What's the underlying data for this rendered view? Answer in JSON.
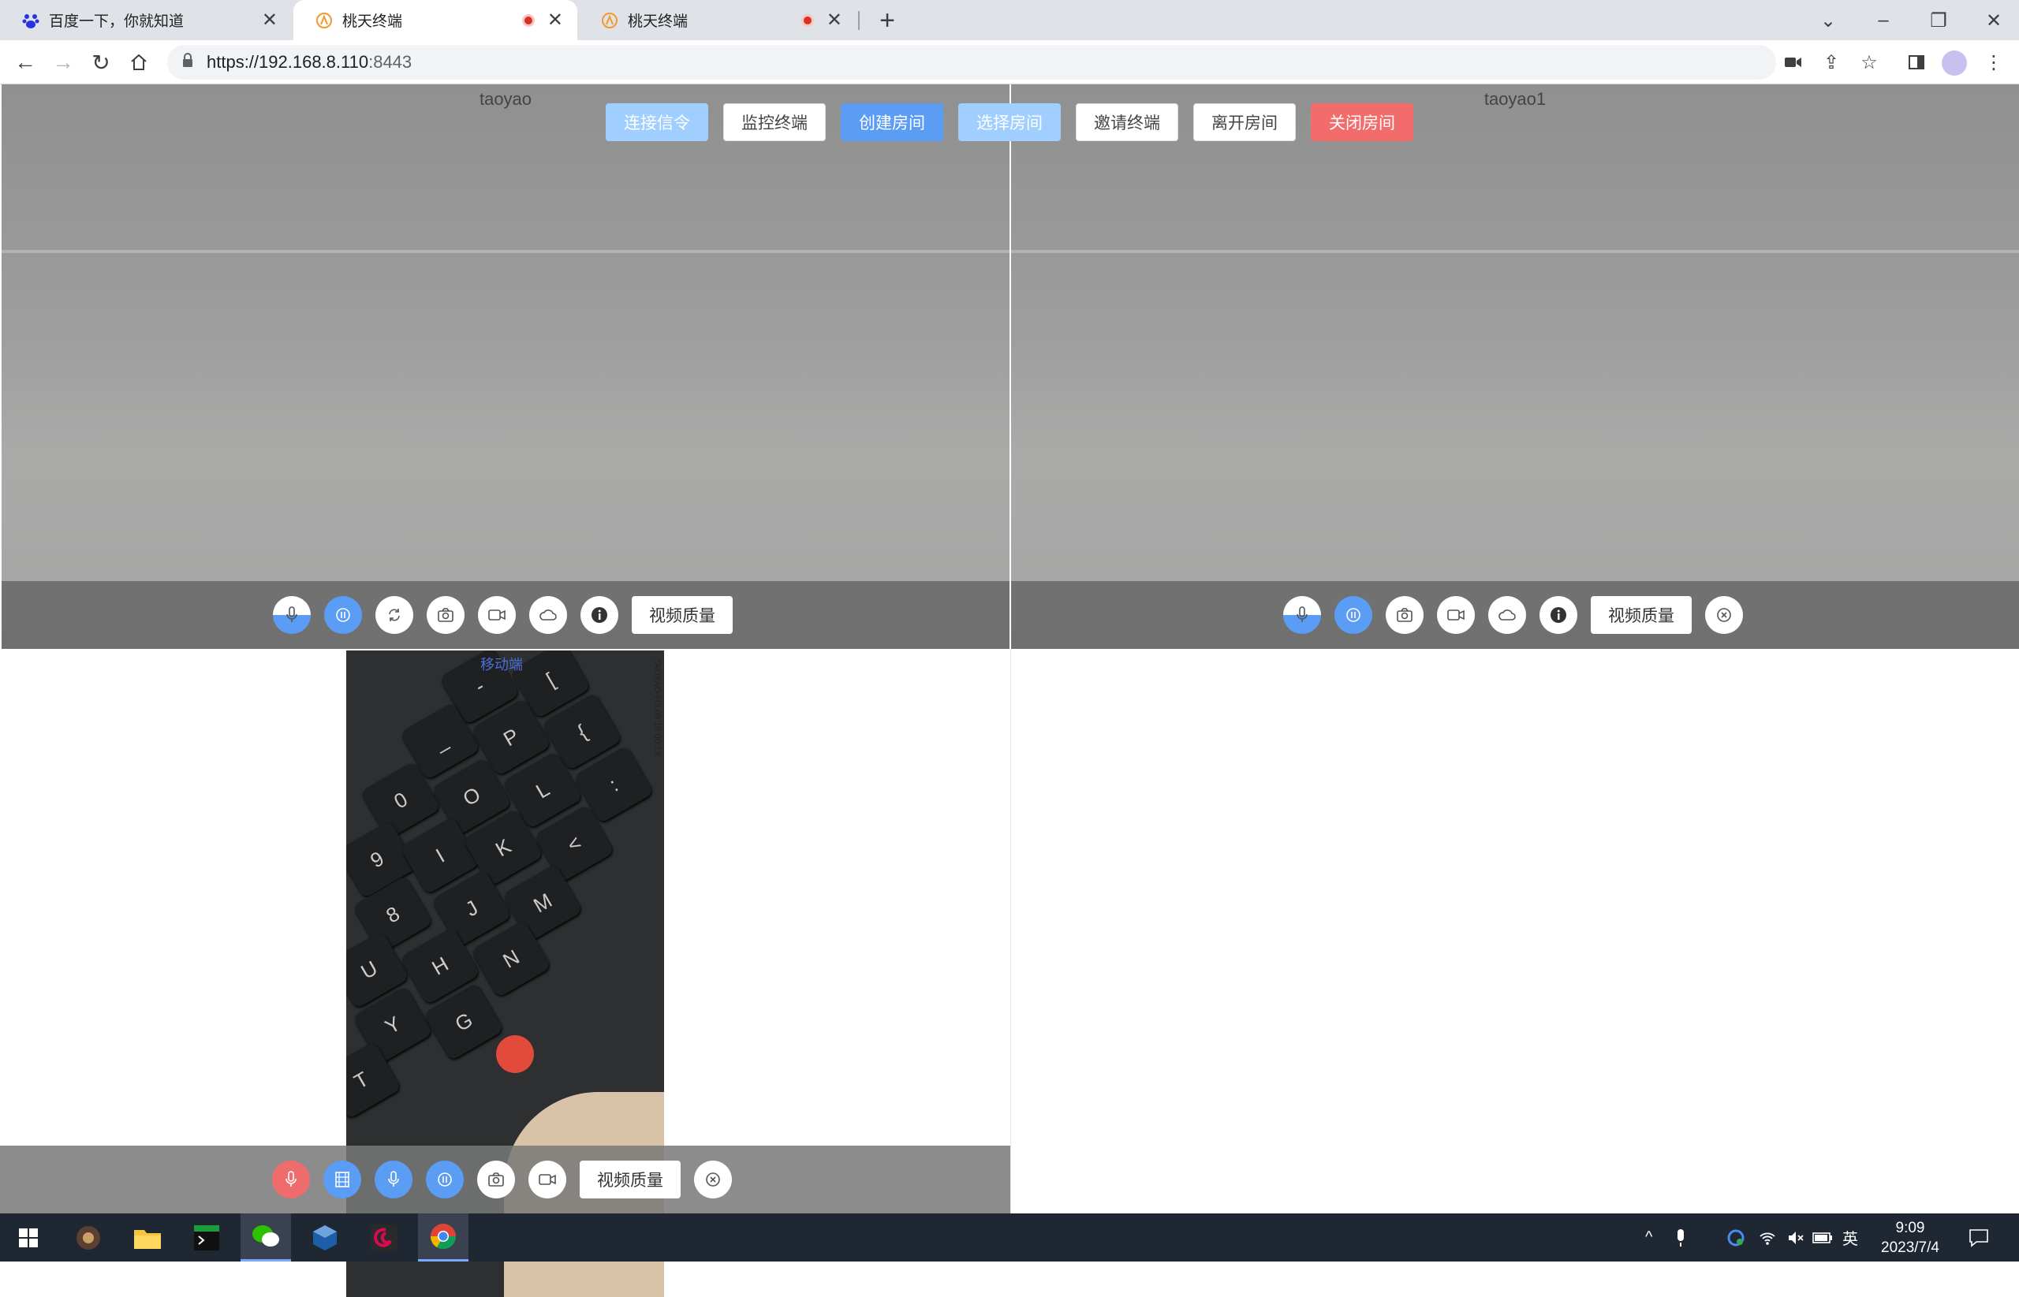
{
  "browser": {
    "tabs": [
      {
        "title": "百度一下，你就知道",
        "favicon": "baidu-paw-icon"
      },
      {
        "title": "桃天终端",
        "favicon": "taotian-logo-icon",
        "recording": true,
        "active": true
      },
      {
        "title": "桃天终端",
        "favicon": "taotian-logo-icon",
        "recording": true
      }
    ],
    "new_tab_label": "+",
    "url_host": "https://192.168.8.110",
    "url_port": ":8443"
  },
  "top_buttons": [
    {
      "label": "连接信令",
      "style": "light"
    },
    {
      "label": "监控终端",
      "style": "default"
    },
    {
      "label": "创建房间",
      "style": "primary"
    },
    {
      "label": "选择房间",
      "style": "light"
    },
    {
      "label": "邀请终端",
      "style": "default"
    },
    {
      "label": "离开房间",
      "style": "default"
    },
    {
      "label": "关闭房间",
      "style": "danger"
    }
  ],
  "panels": [
    {
      "name": "taoyao",
      "quality_label": "视频质量"
    },
    {
      "name": "taoyao1",
      "quality_label": "视频质量"
    },
    {
      "name": "",
      "quality_label": "视频质量"
    }
  ],
  "phone_overlay_text": "移动端",
  "phone_side_text": "TAOYAO-H3 09 18 00.13",
  "taskbar": {
    "time": "9:09",
    "date": "2023/7/4",
    "ime": "英"
  },
  "colors": {
    "primary": "#5b9cf5",
    "light": "#a0cfff",
    "danger": "#f26c6c",
    "taskbar": "#1f2732"
  }
}
